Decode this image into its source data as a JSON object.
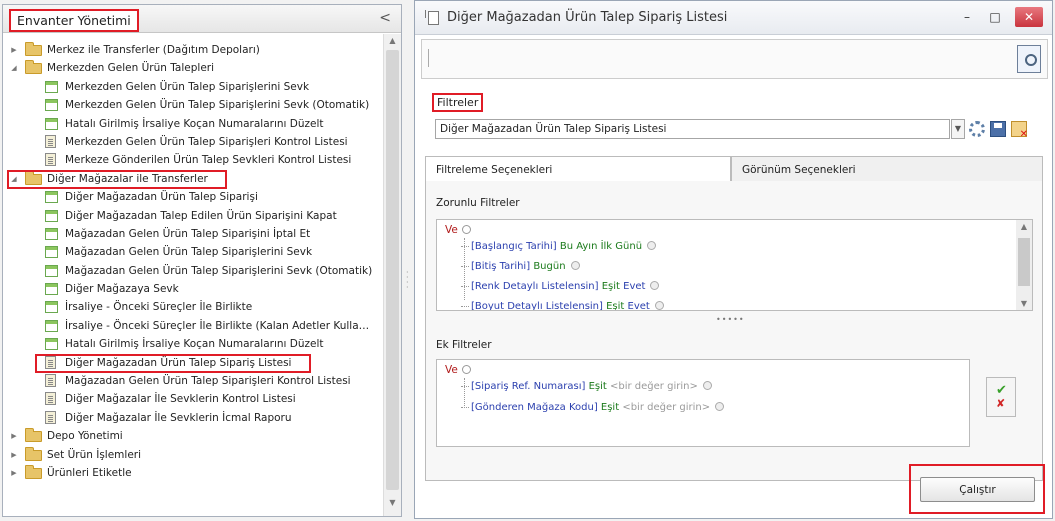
{
  "left_panel": {
    "title": "Envanter Yönetimi",
    "collapse_glyph": "<",
    "tree": [
      {
        "label": "Merkez ile Transferler (Dağıtım Depoları)",
        "type": "folder",
        "expanded": false,
        "level": 0
      },
      {
        "label": "Merkezden Gelen Ürün Talepleri",
        "type": "folder",
        "expanded": true,
        "level": 0
      },
      {
        "label": "Merkezden Gelen Ürün Talep Siparişlerini Sevk",
        "type": "form",
        "level": 1
      },
      {
        "label": "Merkezden Gelen Ürün Talep Siparişlerini Sevk (Otomatik)",
        "type": "form",
        "level": 1
      },
      {
        "label": "Hatalı Girilmiş İrsaliye Koçan Numaralarını Düzelt",
        "type": "form",
        "level": 1
      },
      {
        "label": "Merkezden Gelen Ürün Talep Siparişleri Kontrol Listesi",
        "type": "doc",
        "level": 1
      },
      {
        "label": "Merkeze Gönderilen Ürün Talep Sevkleri Kontrol Listesi",
        "type": "doc",
        "level": 1
      },
      {
        "label": "Diğer Mağazalar ile Transferler",
        "type": "folder",
        "expanded": true,
        "level": 0,
        "highlighted": true
      },
      {
        "label": "Diğer Mağazadan Ürün Talep Siparişi",
        "type": "form",
        "level": 1
      },
      {
        "label": "Diğer Mağazadan Talep Edilen Ürün Siparişini Kapat",
        "type": "form",
        "level": 1
      },
      {
        "label": "Mağazadan Gelen Ürün Talep Siparişini İptal Et",
        "type": "form",
        "level": 1
      },
      {
        "label": "Mağazadan Gelen Ürün Talep Siparişlerini Sevk",
        "type": "form",
        "level": 1
      },
      {
        "label": "Mağazadan Gelen Ürün Talep Siparişlerini Sevk (Otomatik)",
        "type": "form",
        "level": 1
      },
      {
        "label": "Diğer Mağazaya Sevk",
        "type": "form",
        "level": 1
      },
      {
        "label": "İrsaliye - Önceki Süreçler İle Birlikte",
        "type": "form",
        "level": 1
      },
      {
        "label": "İrsaliye - Önceki Süreçler İle Birlikte (Kalan Adetler Kulla…",
        "type": "form",
        "level": 1
      },
      {
        "label": "Hatalı Girilmiş İrsaliye Koçan Numaralarını Düzelt",
        "type": "form",
        "level": 1
      },
      {
        "label": "Diğer Mağazadan Ürün Talep Sipariş Listesi",
        "type": "doc",
        "level": 1,
        "highlighted": true
      },
      {
        "label": "Mağazadan Gelen Ürün Talep Siparişleri Kontrol Listesi",
        "type": "doc",
        "level": 1
      },
      {
        "label": "Diğer Mağazalar İle Sevklerin Kontrol Listesi",
        "type": "doc",
        "level": 1
      },
      {
        "label": "Diğer Mağazalar İle Sevklerin İcmal Raporu",
        "type": "doc",
        "level": 1
      },
      {
        "label": "Depo Yönetimi",
        "type": "folder",
        "expanded": false,
        "level": 0
      },
      {
        "label": "Set Ürün İşlemleri",
        "type": "folder",
        "expanded": false,
        "level": 0
      },
      {
        "label": "Ürünleri Etiketle",
        "type": "folder",
        "expanded": false,
        "level": 0
      }
    ]
  },
  "window": {
    "title": "Diğer Mağazadan Ürün Talep Sipariş Listesi",
    "minimize": "–",
    "maximize": "□",
    "close": "✕"
  },
  "filters": {
    "label": "Filtreler",
    "selected": "Diğer Mağazadan Ürün Talep Sipariş Listesi",
    "tabs": [
      "Filtreleme Seçenekleri",
      "Görünüm Seçenekleri"
    ],
    "required_title": "Zorunlu Filtreler",
    "required_root": "Ve",
    "required": [
      {
        "field": "[Başlangıç Tarihi]",
        "op": "Bu Ayın İlk Günü",
        "value": ""
      },
      {
        "field": "[Bitiş Tarihi]",
        "op": "Bugün",
        "value": ""
      },
      {
        "field": "[Renk Detaylı Listelensin]",
        "op": "Eşit",
        "value": "Evet"
      },
      {
        "field": "[Boyut Detaylı Listelensin]",
        "op": "Eşit",
        "value": "Evet"
      }
    ],
    "extra_title": "Ek Filtreler",
    "extra_root": "Ve",
    "extra": [
      {
        "field": "[Sipariş Ref. Numarası]",
        "op": "Eşit",
        "placeholder": "<bir değer girin>"
      },
      {
        "field": "[Gönderen Mağaza Kodu]",
        "op": "Eşit",
        "placeholder": "<bir değer girin>"
      }
    ],
    "run_label": "Çalıştır"
  }
}
